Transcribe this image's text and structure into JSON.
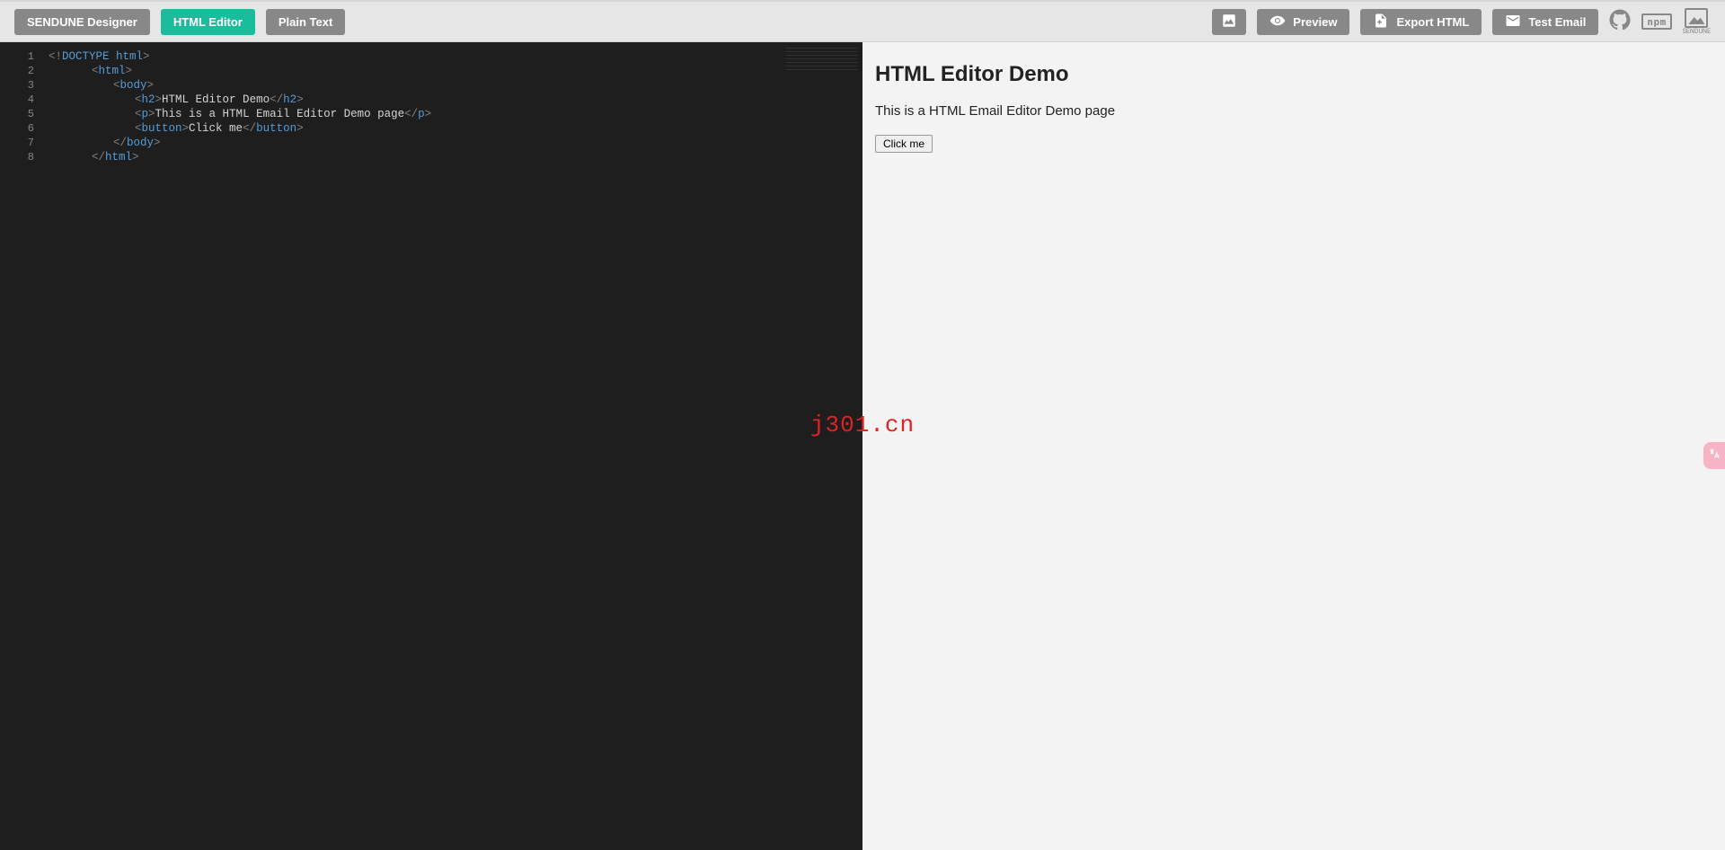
{
  "toolbar": {
    "designer_label": "SENDUNE Designer",
    "html_editor_label": "HTML Editor",
    "plain_text_label": "Plain Text",
    "preview_label": "Preview",
    "export_label": "Export HTML",
    "test_email_label": "Test Email",
    "npm_label": "npm",
    "brand_label": "SENDUNE"
  },
  "editor": {
    "line_numbers": [
      "1",
      "2",
      "3",
      "4",
      "5",
      "6",
      "7",
      "8"
    ],
    "lines": [
      {
        "indent": 0,
        "tokens": [
          {
            "c": "punct",
            "t": "<!"
          },
          {
            "c": "doctype",
            "t": "DOCTYPE html"
          },
          {
            "c": "punct",
            "t": ">"
          }
        ]
      },
      {
        "indent": 1,
        "tokens": [
          {
            "c": "punct",
            "t": "<"
          },
          {
            "c": "tag",
            "t": "html"
          },
          {
            "c": "punct",
            "t": ">"
          }
        ]
      },
      {
        "indent": 2,
        "tokens": [
          {
            "c": "punct",
            "t": "<"
          },
          {
            "c": "tag",
            "t": "body"
          },
          {
            "c": "punct",
            "t": ">"
          }
        ]
      },
      {
        "indent": 3,
        "tokens": [
          {
            "c": "punct",
            "t": "<"
          },
          {
            "c": "tag",
            "t": "h2"
          },
          {
            "c": "punct",
            "t": ">"
          },
          {
            "c": "txt",
            "t": "HTML Editor Demo"
          },
          {
            "c": "punct",
            "t": "</"
          },
          {
            "c": "tag",
            "t": "h2"
          },
          {
            "c": "punct",
            "t": ">"
          }
        ]
      },
      {
        "indent": 3,
        "tokens": [
          {
            "c": "punct",
            "t": "<"
          },
          {
            "c": "tag",
            "t": "p"
          },
          {
            "c": "punct",
            "t": ">"
          },
          {
            "c": "txt",
            "t": "This is a HTML Email Editor Demo page"
          },
          {
            "c": "punct",
            "t": "</"
          },
          {
            "c": "tag",
            "t": "p"
          },
          {
            "c": "punct",
            "t": ">"
          }
        ]
      },
      {
        "indent": 3,
        "tokens": [
          {
            "c": "punct",
            "t": "<"
          },
          {
            "c": "tag",
            "t": "button"
          },
          {
            "c": "punct",
            "t": ">"
          },
          {
            "c": "txt",
            "t": "Click me"
          },
          {
            "c": "punct",
            "t": "</"
          },
          {
            "c": "tag",
            "t": "button"
          },
          {
            "c": "punct",
            "t": ">"
          }
        ]
      },
      {
        "indent": 2,
        "tokens": [
          {
            "c": "punct",
            "t": "</"
          },
          {
            "c": "tag",
            "t": "body"
          },
          {
            "c": "punct",
            "t": ">"
          }
        ]
      },
      {
        "indent": 1,
        "tokens": [
          {
            "c": "punct",
            "t": "</"
          },
          {
            "c": "tag",
            "t": "html"
          },
          {
            "c": "punct",
            "t": ">"
          }
        ]
      }
    ]
  },
  "preview": {
    "heading": "HTML Editor Demo",
    "paragraph": "This is a HTML Email Editor Demo page",
    "button_label": "Click me"
  },
  "watermark": "j301.cn"
}
